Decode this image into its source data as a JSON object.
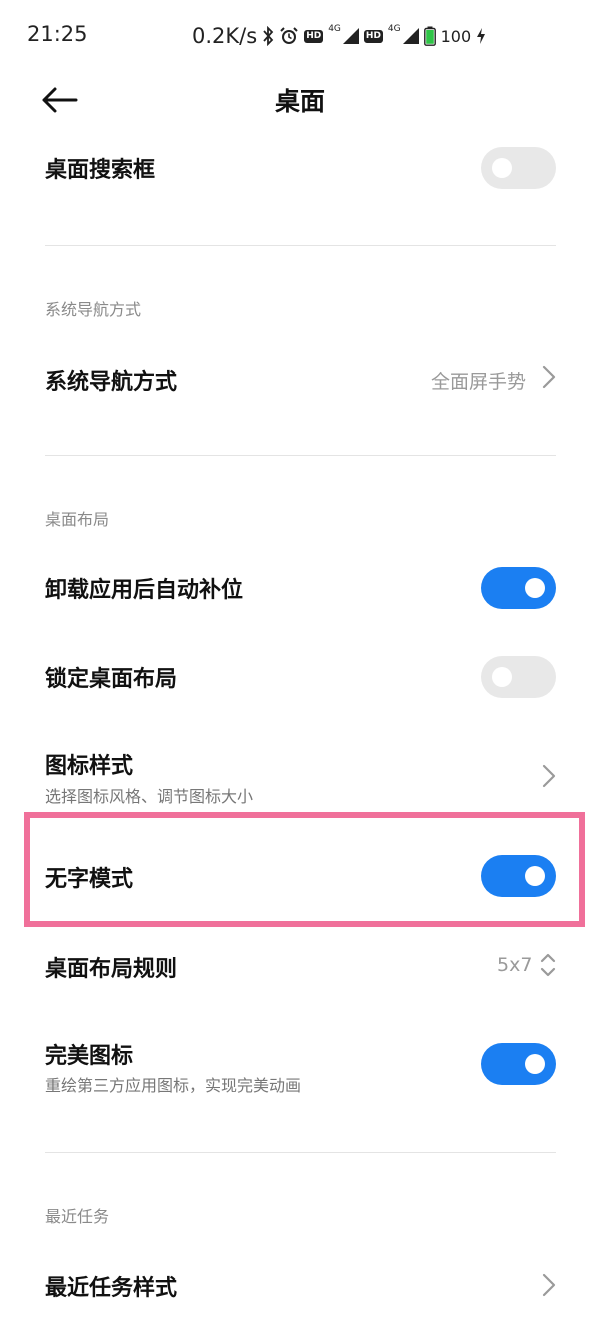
{
  "status_bar": {
    "time": "21:25",
    "speed": "0.2K/s",
    "hd1": "HD",
    "net1": "4G",
    "hd2": "HD",
    "net2": "4G",
    "battery": "100"
  },
  "header": {
    "title": "桌面"
  },
  "rows": {
    "search_box": {
      "title": "桌面搜索框",
      "enabled": false
    },
    "nav_section": "系统导航方式",
    "nav_mode": {
      "title": "系统导航方式",
      "value": "全面屏手势"
    },
    "layout_section": "桌面布局",
    "auto_fill": {
      "title": "卸载应用后自动补位",
      "enabled": true
    },
    "lock_layout": {
      "title": "锁定桌面布局",
      "enabled": false
    },
    "icon_style": {
      "title": "图标样式",
      "subtitle": "选择图标风格、调节图标大小"
    },
    "no_text_mode": {
      "title": "无字模式",
      "enabled": true
    },
    "layout_rule": {
      "title": "桌面布局规则",
      "value": "5x7"
    },
    "perfect_icons": {
      "title": "完美图标",
      "subtitle": "重绘第三方应用图标，实现完美动画",
      "enabled": true
    },
    "recent_section": "最近任务",
    "recent_style": {
      "title": "最近任务样式"
    }
  },
  "colors": {
    "accent": "#1b7ff2",
    "highlight": "#f0709a",
    "toggle_off": "#e8e8e8"
  }
}
